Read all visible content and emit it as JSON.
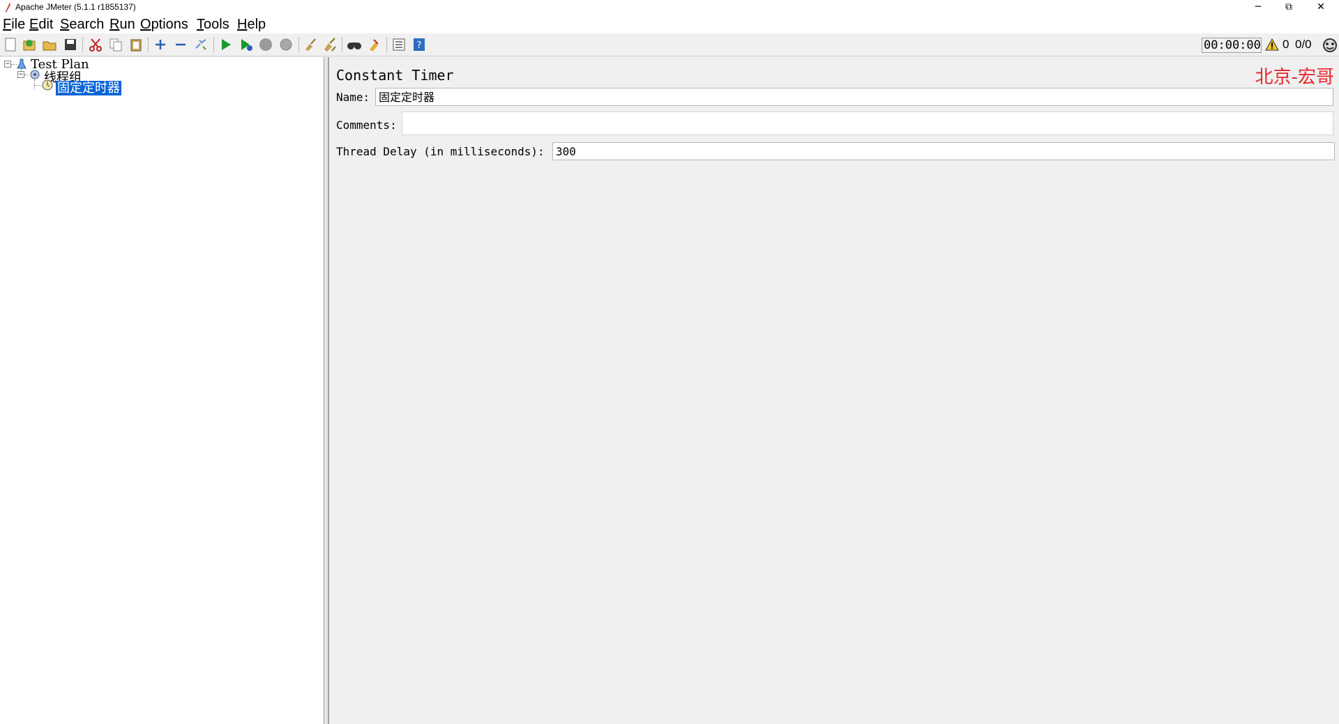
{
  "window": {
    "title": "Apache JMeter (5.1.1 r1855137)",
    "minimize_glyph": "─",
    "maximize_glyph": "⧉",
    "close_glyph": "✕"
  },
  "menu": {
    "file": {
      "mnemonic": "F",
      "rest": "ile"
    },
    "edit": {
      "mnemonic": "E",
      "rest": "dit"
    },
    "search": {
      "mnemonic": "S",
      "rest": "earch"
    },
    "run": {
      "mnemonic": "R",
      "rest": "un"
    },
    "options": {
      "mnemonic": "O",
      "rest": "ptions"
    },
    "tools": {
      "mnemonic": "T",
      "rest": "ools"
    },
    "help": {
      "mnemonic": "H",
      "rest": "elp"
    }
  },
  "toolbar": {
    "icons": [
      "new-icon",
      "templates-icon",
      "open-icon",
      "save-icon",
      "cut-icon",
      "copy-icon",
      "paste-icon",
      "expand-icon",
      "collapse-icon",
      "toggle-icon",
      "start-icon",
      "start-no-pause-icon",
      "stop-icon",
      "shutdown-icon",
      "clear-icon",
      "clear-all-icon",
      "search-icon",
      "reset-search-icon",
      "function-helper-icon",
      "help-icon"
    ],
    "elapsed_time": "00:00:00",
    "warning_count": "0",
    "thread_count": "0/0"
  },
  "tree": {
    "root_label": "Test Plan",
    "thread_group_label": "线程组",
    "timer_label": "固定定时器",
    "collapse_glyph": "−"
  },
  "panel": {
    "title": "Constant Timer",
    "watermark": "北京-宏哥",
    "name_label": "Name:",
    "name_value": "固定定时器",
    "comments_label": "Comments:",
    "comments_value": "",
    "delay_label": "Thread Delay (in milliseconds):",
    "delay_value": "300"
  },
  "colors": {
    "selection": "#0a64d8",
    "watermark": "#e8262a",
    "start_green": "#1a9a2c"
  }
}
